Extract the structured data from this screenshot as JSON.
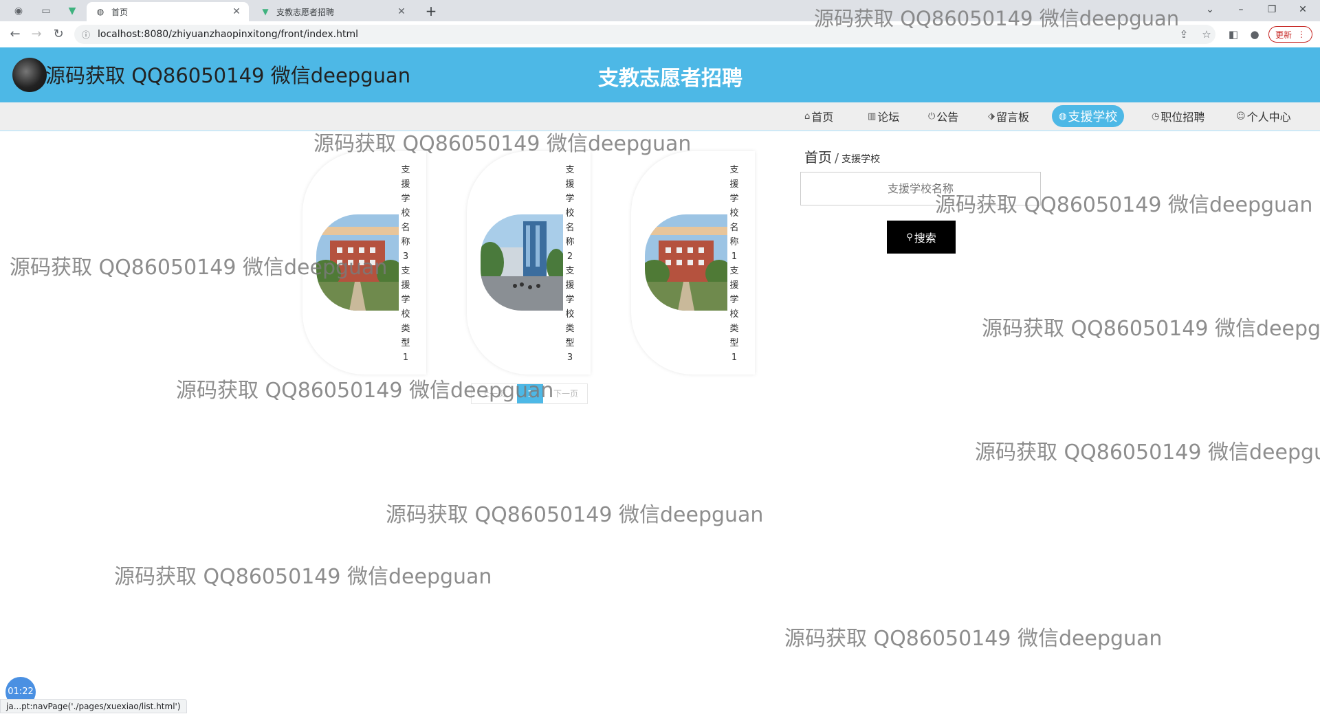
{
  "browser": {
    "tabs": [
      {
        "label": "首页",
        "active": true
      },
      {
        "label": "支教志愿者招聘",
        "active": false
      }
    ],
    "url": "localhost:8080/zhiyuanzhaopinxitong/front/index.html",
    "update_label": "更新",
    "status_text": "ja...pt:navPage('./pages/xuexiao/list.html')"
  },
  "header": {
    "title": "支教志愿者招聘",
    "notice": "源码获取 QQ86050149 微信deepguan"
  },
  "nav": {
    "items": [
      {
        "label": "首页",
        "icon": "home-icon"
      },
      {
        "label": "论坛",
        "icon": "forum-icon"
      },
      {
        "label": "公告",
        "icon": "power-icon"
      },
      {
        "label": "留言板",
        "icon": "tag-icon"
      },
      {
        "label": "支援学校",
        "icon": "globe-icon",
        "active": true
      },
      {
        "label": "职位招聘",
        "icon": "clock-icon"
      },
      {
        "label": "个人中心",
        "icon": "user-icon"
      }
    ]
  },
  "schools": [
    {
      "name": "支援学校名称3",
      "type": "支援学校类型1"
    },
    {
      "name": "支援学校名称2",
      "type": "支援学校类型3"
    },
    {
      "name": "支援学校名称1",
      "type": "支援学校类型1"
    }
  ],
  "pagination": {
    "prev": "上一页",
    "current": "1",
    "next": "下一页"
  },
  "breadcrumb": {
    "home": "首页",
    "separator": "/",
    "current": "支援学校"
  },
  "search": {
    "placeholder": "支援学校名称",
    "button_label": "搜索"
  },
  "watermark": "源码获取 QQ86050149 微信deepguan",
  "video_timer": "01:22",
  "colors": {
    "primary": "#4db8e6",
    "search_button": "#000000"
  }
}
